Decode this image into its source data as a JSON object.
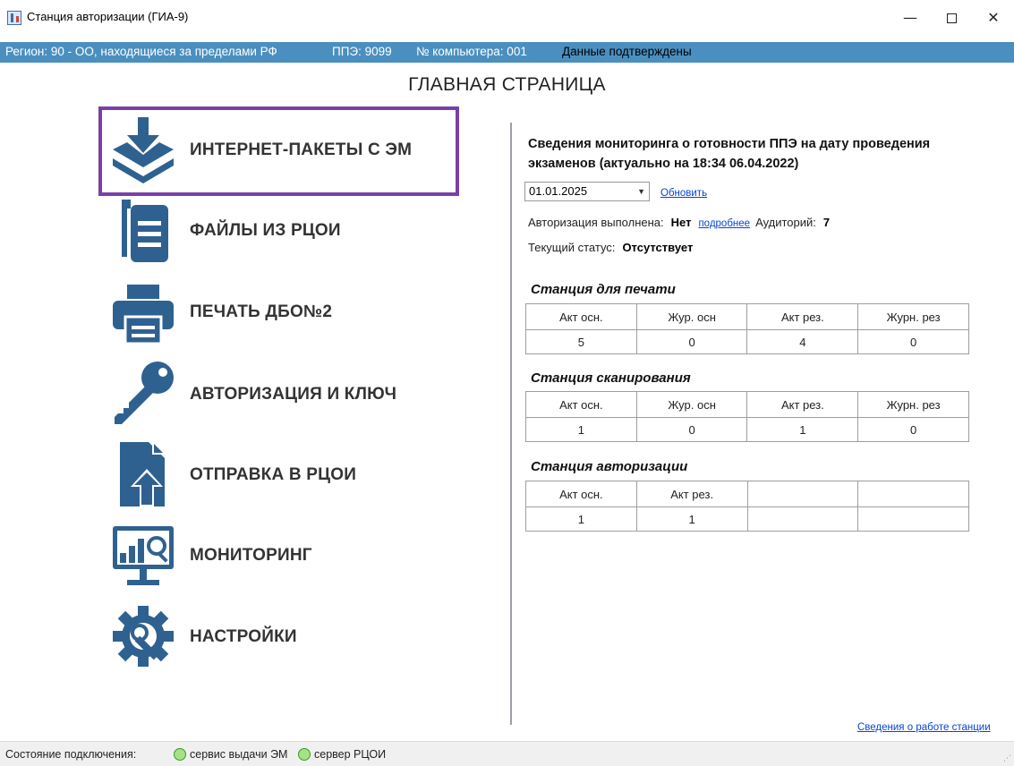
{
  "window": {
    "title": "Станция авторизации (ГИА-9)",
    "minimize": "—",
    "close": "✕"
  },
  "infobar": {
    "region": "Регион: 90 - ОО, находящиеся за пределами РФ",
    "ppe": "ППЭ: 9099",
    "computer": "№ компьютера: 001",
    "confirmed": "Данные подтверждены"
  },
  "page_title": "ГЛАВНАЯ СТРАНИЦА",
  "menu": [
    {
      "label": "ИНТЕРНЕТ-ПАКЕТЫ С ЭМ",
      "icon": "download-tray-icon",
      "selected": true
    },
    {
      "label": "ФАЙЛЫ ИЗ РЦОИ",
      "icon": "documents-icon"
    },
    {
      "label": "ПЕЧАТЬ ДБО№2",
      "icon": "printer-icon"
    },
    {
      "label": "АВТОРИЗАЦИЯ И КЛЮЧ",
      "icon": "key-icon"
    },
    {
      "label": "ОТПРАВКА В РЦОИ",
      "icon": "upload-file-icon"
    },
    {
      "label": "МОНИТОРИНГ",
      "icon": "monitor-chart-icon"
    },
    {
      "label": "НАСТРОЙКИ",
      "icon": "gear-wrench-icon"
    }
  ],
  "monitoring": {
    "title": "Сведения мониторинга о готовности ППЭ на дату проведения экзаменов (актуально на 18:34 06.04.2022)",
    "date_value": "01.01.2025",
    "refresh_label": "Обновить",
    "auth_label": "Авторизация выполнена:",
    "auth_value": "Нет",
    "more_label": "подробнее",
    "audiences_label": "Аудиторий:",
    "audiences_value": "7",
    "status_label": "Текущий статус:",
    "status_value": "Отсутствует"
  },
  "stations": [
    {
      "title": "Станция для печати",
      "headers": [
        "Акт осн.",
        "Жур. осн",
        "Акт рез.",
        "Журн. рез"
      ],
      "values": [
        "5",
        "0",
        "4",
        "0"
      ]
    },
    {
      "title": "Станция сканирования",
      "headers": [
        "Акт осн.",
        "Жур. осн",
        "Акт рез.",
        "Журн. рез"
      ],
      "values": [
        "1",
        "0",
        "1",
        "0"
      ]
    },
    {
      "title": "Станция авторизации",
      "headers": [
        "Акт осн.",
        "Акт рез.",
        "",
        ""
      ],
      "values": [
        "1",
        "1",
        "",
        ""
      ]
    }
  ],
  "footer_link": "Сведения о работе станции",
  "statusbar": {
    "label": "Состояние подключения:",
    "service1": "сервис выдачи ЭМ",
    "service2": "сервер РЦОИ"
  },
  "colors": {
    "infobar": "#4a8fbf",
    "icons": "#2f6190",
    "selection": "#7a3fa8",
    "status_ok": "#a8e08a"
  }
}
